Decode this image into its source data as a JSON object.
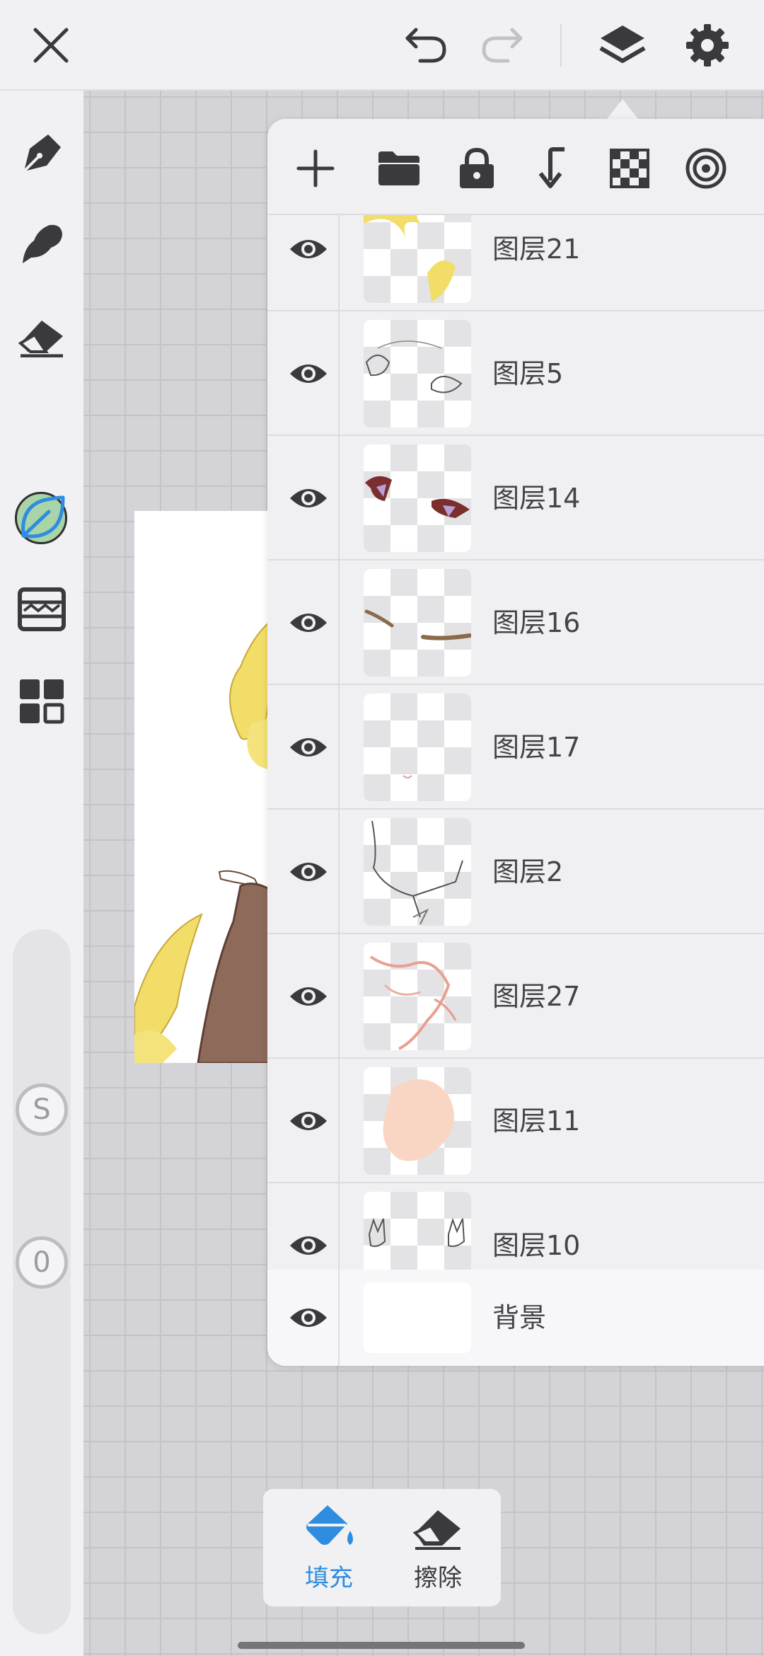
{
  "colors": {
    "accent": "#2e8de0",
    "icon": "#3a3a3c",
    "icon_disabled": "#c2c2c4",
    "current_color": "#a8d4a8"
  },
  "topbar": {
    "icons": [
      "close-icon",
      "undo-icon",
      "redo-icon",
      "layers-icon",
      "settings-icon"
    ]
  },
  "sidebar": {
    "tools": [
      "pen-icon",
      "brush-icon",
      "eraser-icon",
      "color-picker",
      "fill-leaf-icon",
      "ruler-icon",
      "grid-menu-icon"
    ],
    "size_slider_label": "S",
    "opacity_slider_label": "0"
  },
  "layers_panel": {
    "toolbar_icons": [
      "add-layer-icon",
      "folder-icon",
      "lock-icon",
      "merge-down-icon",
      "transparency-icon",
      "target-icon"
    ],
    "layers": [
      {
        "name": "图层21"
      },
      {
        "name": "图层5"
      },
      {
        "name": "图层14"
      },
      {
        "name": "图层16"
      },
      {
        "name": "图层17"
      },
      {
        "name": "图层2"
      },
      {
        "name": "图层27"
      },
      {
        "name": "图层11"
      },
      {
        "name": "图层10"
      }
    ],
    "background": {
      "name": "背景"
    }
  },
  "bottom_tools": {
    "fill_label": "填充",
    "erase_label": "擦除"
  }
}
